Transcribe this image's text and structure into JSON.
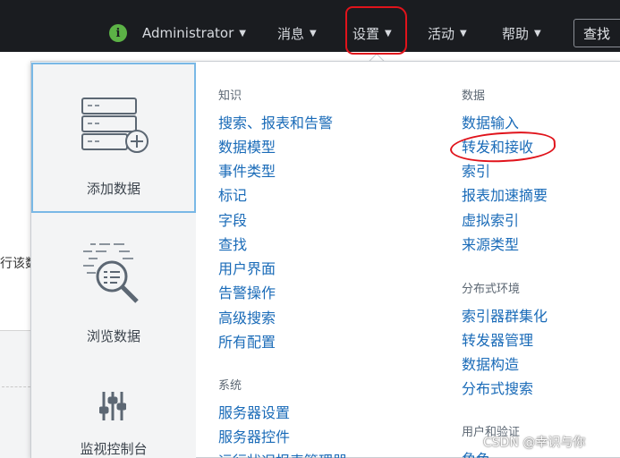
{
  "topbar": {
    "user": "Administrator",
    "menus": [
      "消息",
      "设置",
      "活动",
      "帮助"
    ],
    "search": "查找"
  },
  "background": {
    "snippet": "行该数"
  },
  "sidebar": {
    "tiles": [
      {
        "label": "添加数据",
        "icon": "add-data-icon"
      },
      {
        "label": "浏览数据",
        "icon": "explore-data-icon"
      },
      {
        "label": "监视控制台",
        "icon": "monitoring-console-icon"
      }
    ]
  },
  "sections": {
    "knowledge": {
      "title": "知识",
      "items": [
        "搜索、报表和告警",
        "数据模型",
        "事件类型",
        "标记",
        "字段",
        "查找",
        "用户界面",
        "告警操作",
        "高级搜索",
        "所有配置"
      ]
    },
    "system": {
      "title": "系统",
      "items": [
        "服务器设置",
        "服务器控件",
        "运行状况报表管理器"
      ]
    },
    "data": {
      "title": "数据",
      "items": [
        "数据输入",
        "转发和接收",
        "索引",
        "报表加速摘要",
        "虚拟索引",
        "来源类型"
      ]
    },
    "distributed": {
      "title": "分布式环境",
      "items": [
        "索引器群集化",
        "转发器管理",
        "数据构造",
        "分布式搜索"
      ]
    },
    "users": {
      "title": "用户和验证",
      "items": [
        "角色"
      ]
    }
  },
  "watermark": "CSDN @幸识与你",
  "colors": {
    "topbar": "#1a1c20",
    "link": "#1a6bb8",
    "annotation": "#e0131b",
    "selected_tile_border": "#79b8e6"
  }
}
